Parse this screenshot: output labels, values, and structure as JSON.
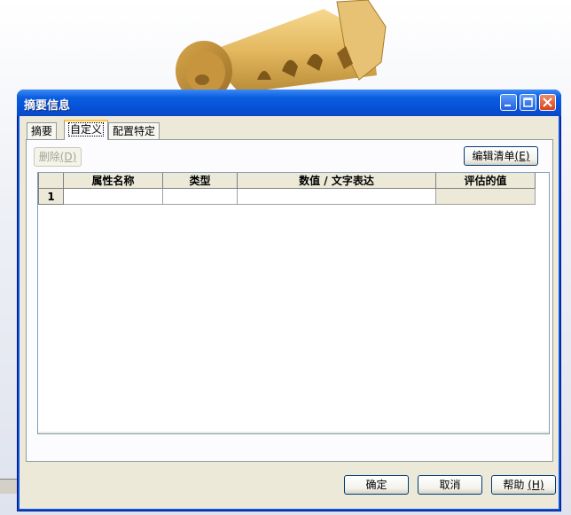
{
  "dialog": {
    "title": "摘要信息"
  },
  "tabs": [
    {
      "label": "摘要",
      "active": false
    },
    {
      "label": "自定义",
      "active": true
    },
    {
      "label": "配置特定",
      "active": false
    }
  ],
  "toolbar": {
    "delete_label": "删除",
    "delete_key": "(D)",
    "edit_list_label": "编辑清单",
    "edit_list_key": "(E)"
  },
  "grid": {
    "columns": [
      "属性名称",
      "类型",
      "数值 / 文字表达",
      "评估的值"
    ],
    "rows": [
      {
        "num": "1",
        "name": "",
        "type": "",
        "value": "",
        "evaluated": ""
      }
    ]
  },
  "footer": {
    "ok_label": "确定",
    "cancel_label": "取消",
    "help_label": "帮助",
    "help_key": "(H)"
  },
  "colors": {
    "titlebar": "#0a5ee0",
    "dialog_bg": "#ece9d8",
    "part_gold": "#e0b763"
  }
}
